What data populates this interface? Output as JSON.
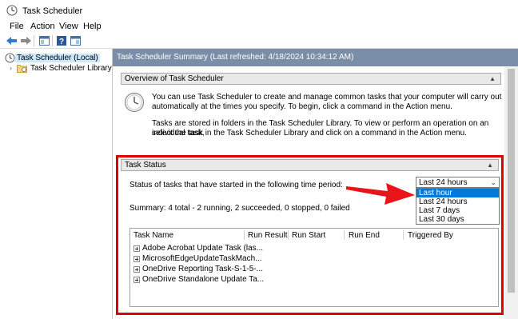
{
  "window": {
    "title": "Task Scheduler"
  },
  "menu": [
    "File",
    "Action",
    "View",
    "Help"
  ],
  "toolbar": [
    "back-icon",
    "forward-icon",
    "console-tree-icon",
    "help-icon",
    "show-hide-icon"
  ],
  "tree": {
    "root": "Task Scheduler (Local)",
    "child": "Task Scheduler Library"
  },
  "summary": {
    "header": "Task Scheduler Summary (Last refreshed: 4/18/2024 10:34:12 AM)"
  },
  "overview": {
    "title": "Overview of Task Scheduler",
    "line1": "You can use Task Scheduler to create and manage common tasks that your computer will carry out",
    "line2": "automatically at the times you specify. To begin, click a command in the Action menu.",
    "line3": "Tasks are stored in folders in the Task Scheduler Library. To view or perform an operation on an individual task,",
    "line4": "select the task in the Task Scheduler Library and click on a command in the Action menu."
  },
  "task_status": {
    "title": "Task Status",
    "period_label": "Status of tasks that have started in the following time period:",
    "selected": "Last 24 hours",
    "options": [
      "Last hour",
      "Last 24 hours",
      "Last 7 days",
      "Last 30 days"
    ],
    "summary": "Summary: 4 total - 2 running, 2 succeeded, 0 stopped, 0 failed",
    "columns": [
      "Task Name",
      "Run Result",
      "Run Start",
      "Run End",
      "Triggered By"
    ],
    "rows": [
      "Adobe Acrobat Update Task (las...",
      "MicrosoftEdgeUpdateTaskMach...",
      "OneDrive Reporting Task-S-1-5-...",
      "OneDrive Standalone Update Ta..."
    ]
  },
  "colors": {
    "highlight": "#e00000",
    "selection": "#0078d7",
    "header": "#7a8ea8"
  }
}
